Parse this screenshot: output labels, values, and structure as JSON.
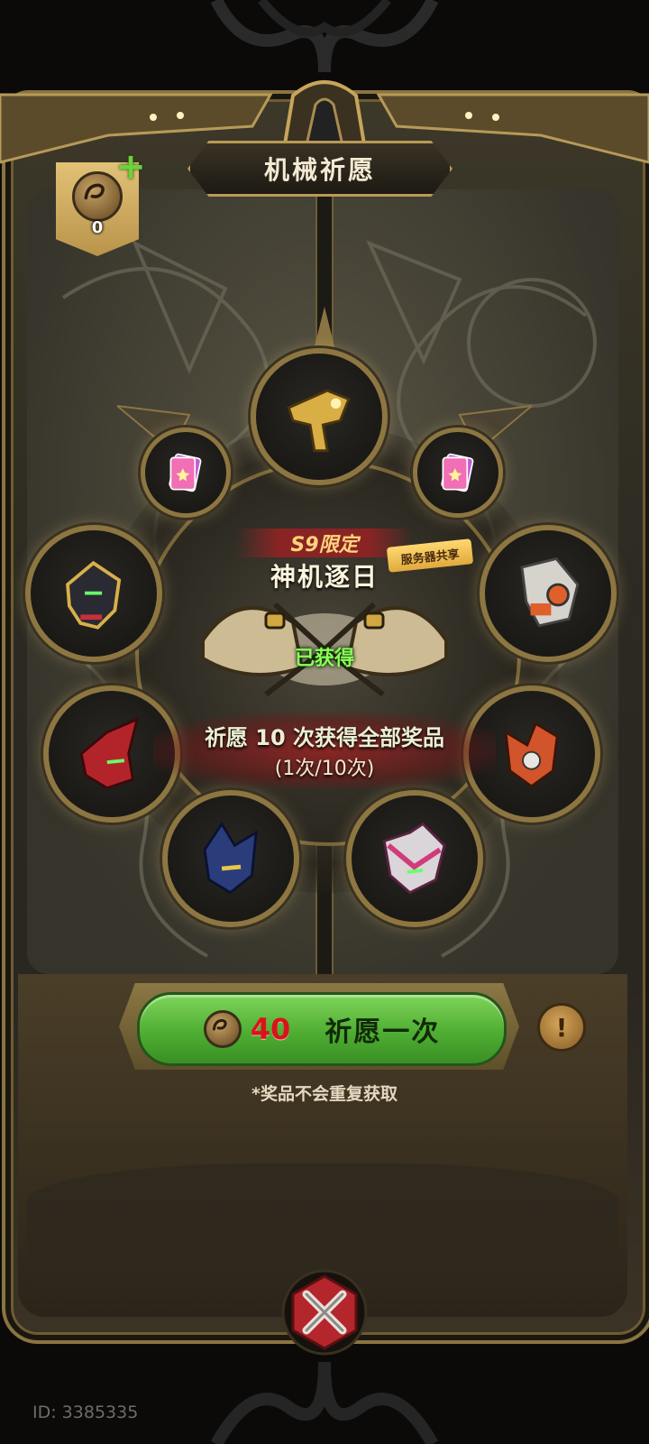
{
  "header": {
    "title": "机械祈愿"
  },
  "currency": {
    "value": "0",
    "icon": "prayer-coin-icon",
    "add_icon": "plus-icon"
  },
  "center": {
    "badge": "S9限定",
    "prize_name": "神机逐日",
    "shared_tag": "服务器共享",
    "obtained": "已获得",
    "progress_line1": "祈愿 10 次获得全部奖品",
    "progress_line2": "(1次/10次)"
  },
  "rewards": [
    {
      "slot": "top",
      "icon": "gold-mech-icon"
    },
    {
      "slot": "upper-left",
      "icon": "ticket-icon"
    },
    {
      "slot": "upper-right",
      "icon": "ticket-icon"
    },
    {
      "slot": "left",
      "icon": "black-gold-mech-icon"
    },
    {
      "slot": "right",
      "icon": "white-orange-mech-icon"
    },
    {
      "slot": "lower-left",
      "icon": "red-mech-icon"
    },
    {
      "slot": "lower-right",
      "icon": "orange-mech-icon"
    },
    {
      "slot": "bottom-left",
      "icon": "blue-mech-icon"
    },
    {
      "slot": "bottom-right",
      "icon": "pink-mech-icon"
    }
  ],
  "pray_button": {
    "cost": "40",
    "label": "祈愿一次"
  },
  "info_button": {
    "label": "!"
  },
  "note": "*奖品不会重复获取",
  "footer": {
    "id_label": "ID: 3385335"
  },
  "colors": {
    "frame_gold": "#8b7441",
    "button_green": "#4fae32",
    "cost_red": "#d8141b",
    "obtained_green": "#8aff5a"
  }
}
